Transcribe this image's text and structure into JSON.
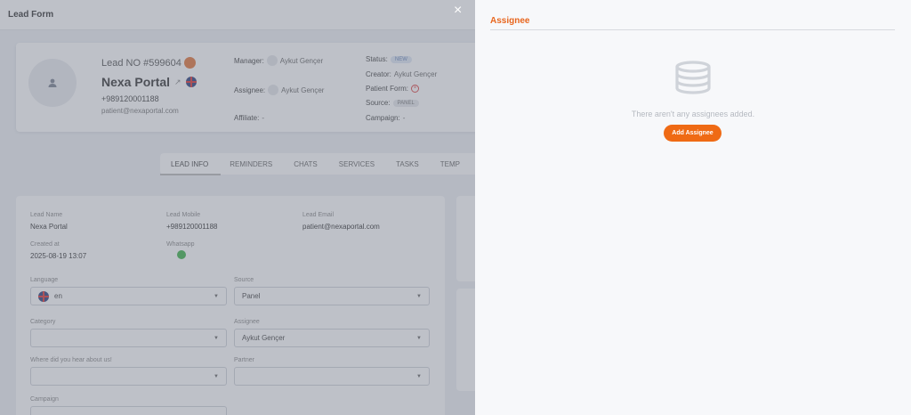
{
  "form": {
    "title": "Lead Form",
    "close_icon": "×"
  },
  "lead": {
    "number": "Lead NO #599604",
    "name": "Nexa Portal",
    "phone": "+989120001188",
    "email": "patient@nexaportal.com"
  },
  "meta": {
    "manager_label": "Manager:",
    "manager_value": "Aykut Gençer",
    "assignee_label": "Assignee:",
    "assignee_value": "Aykut Gençer",
    "affiliate_label": "Affiliate:",
    "affiliate_value": "-",
    "status_label": "Status:",
    "status_value": "NEW",
    "creator_label": "Creator:",
    "creator_value": "Aykut Gençer",
    "patient_form_label": "Patient Form:",
    "source_label": "Source:",
    "source_value": "PANEL",
    "campaign_label": "Campaign:",
    "campaign_value": "-"
  },
  "tabs": [
    "LEAD INFO",
    "REMINDERS",
    "CHATS",
    "SERVICES",
    "TASKS",
    "TEMP"
  ],
  "fields": {
    "lead_name_label": "Lead Name",
    "lead_name_value": "Nexa Portal",
    "lead_mobile_label": "Lead Mobile",
    "lead_mobile_value": "+989120001188",
    "lead_email_label": "Lead Email",
    "lead_email_value": "patient@nexaportal.com",
    "created_at_label": "Created at",
    "created_at_value": "2025-08-19 13:07",
    "whatsapp_label": "Whatsapp",
    "language_label": "Language",
    "language_value": "en",
    "source_label": "Source",
    "source_value": "Panel",
    "category_label": "Category",
    "category_value": "",
    "assignee_label": "Assignee",
    "assignee_value": "Aykut Gençer",
    "heard_label": "Where did you hear about us!",
    "heard_value": "",
    "partner_label": "Partner",
    "partner_value": "",
    "campaign_label": "Campaign"
  },
  "drawer": {
    "title": "Assignee",
    "empty_text": "There aren't any assignees added.",
    "add_button": "Add Assignee",
    "accent_color": "#e8661e",
    "icon": "database-icon"
  }
}
